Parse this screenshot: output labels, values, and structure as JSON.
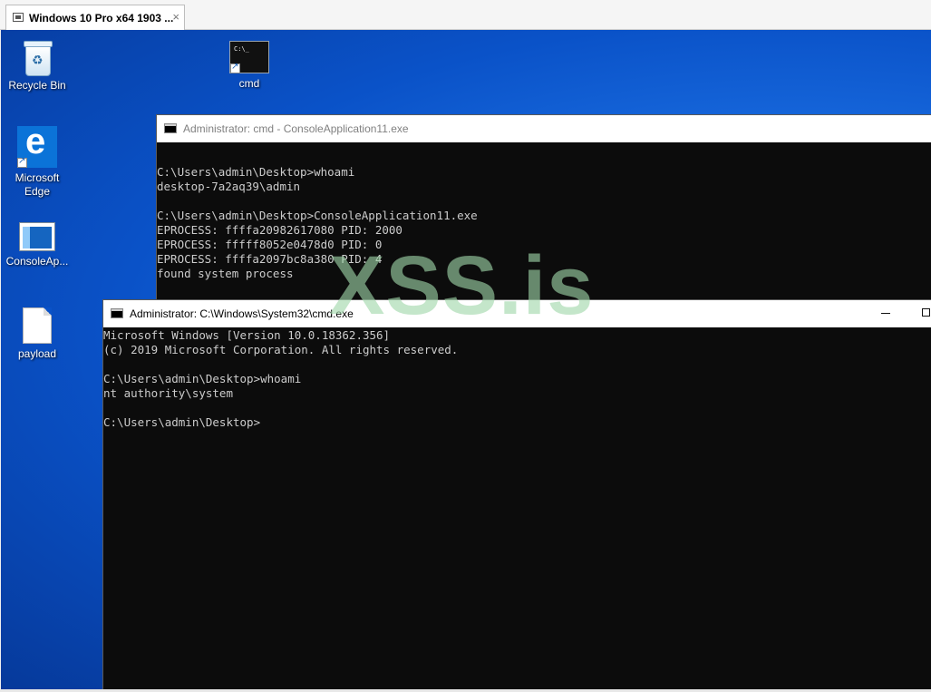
{
  "vm": {
    "tab_title": "Windows 10 Pro x64 1903 ...",
    "close_glyph": "×"
  },
  "desktop": {
    "icons": [
      {
        "label": "Recycle Bin",
        "icon": "recycle-bin-icon"
      },
      {
        "label": "cmd",
        "icon": "cmd-icon"
      },
      {
        "label": "Microsoft Edge",
        "icon": "edge-icon"
      },
      {
        "label": "ConsoleAp...",
        "icon": "application-icon"
      },
      {
        "label": "payload",
        "icon": "file-icon"
      }
    ]
  },
  "window_back": {
    "title": "Administrator: cmd - ConsoleApplication11.exe",
    "lines": [
      "",
      "C:\\Users\\admin\\Desktop>whoami",
      "desktop-7a2aq39\\admin",
      "",
      "C:\\Users\\admin\\Desktop>ConsoleApplication11.exe",
      "EPROCESS: ffffa20982617080 PID: 2000",
      "EPROCESS: fffff8052e0478d0 PID: 0",
      "EPROCESS: ffffa2097bc8a380 PID: 4",
      "found system process"
    ]
  },
  "window_front": {
    "title": "Administrator: C:\\Windows\\System32\\cmd.exe",
    "lines": [
      "Microsoft Windows [Version 10.0.18362.356]",
      "(c) 2019 Microsoft Corporation. All rights reserved.",
      "",
      "C:\\Users\\admin\\Desktop>whoami",
      "nt authority\\system",
      "",
      "C:\\Users\\admin\\Desktop>"
    ]
  },
  "watermark": "XSS.is",
  "colors": {
    "desktop_blue": "#0a52c8",
    "console_bg": "#0c0c0c",
    "console_text": "#cccccc"
  }
}
